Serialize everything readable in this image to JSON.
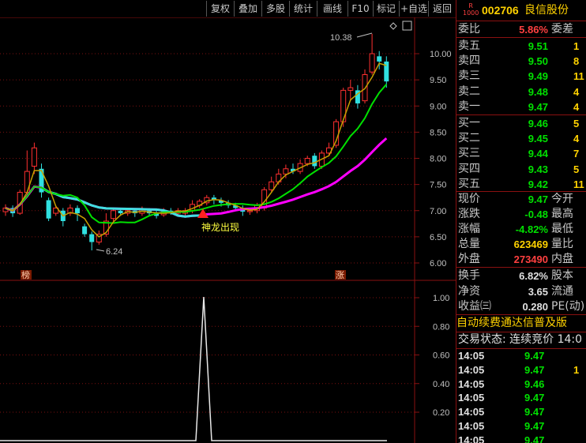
{
  "toolbar": {
    "buttons": [
      "复权",
      "叠加",
      "多股",
      "统计",
      "画线",
      "F10",
      "标记",
      "+自选",
      "返回"
    ]
  },
  "stock": {
    "badge_top": "R",
    "badge_bottom": "1000",
    "code": "002706",
    "name": "良信股份"
  },
  "order_book": {
    "weibi_label": "委比",
    "weibi_value": "5.86%",
    "weicha_label": "委差",
    "sell": [
      {
        "label": "卖五",
        "price": "9.51",
        "vol": "1"
      },
      {
        "label": "卖四",
        "price": "9.50",
        "vol": "8"
      },
      {
        "label": "卖三",
        "price": "9.49",
        "vol": "11"
      },
      {
        "label": "卖二",
        "price": "9.48",
        "vol": "4"
      },
      {
        "label": "卖一",
        "price": "9.47",
        "vol": "4"
      }
    ],
    "buy": [
      {
        "label": "买一",
        "price": "9.46",
        "vol": "5"
      },
      {
        "label": "买二",
        "price": "9.45",
        "vol": "4"
      },
      {
        "label": "买三",
        "price": "9.44",
        "vol": "7"
      },
      {
        "label": "买四",
        "price": "9.43",
        "vol": "5"
      },
      {
        "label": "买五",
        "price": "9.42",
        "vol": "11"
      }
    ]
  },
  "quote": {
    "rows": [
      {
        "label": "现价",
        "value": "9.47",
        "color": "#00e000",
        "label2": "今开"
      },
      {
        "label": "涨跌",
        "value": "-0.48",
        "color": "#00e000",
        "label2": "最高"
      },
      {
        "label": "涨幅",
        "value": "-4.82%",
        "color": "#00e000",
        "label2": "最低"
      },
      {
        "label": "总量",
        "value": "623469",
        "color": "#ffd200",
        "label2": "量比"
      },
      {
        "label": "外盘",
        "value": "273490",
        "color": "#ff4040",
        "label2": "内盘"
      }
    ],
    "rows2": [
      {
        "label": "换手",
        "value": "6.82%",
        "color": "#e0e0e0",
        "label2": "股本"
      },
      {
        "label": "净资",
        "value": "3.65",
        "color": "#e0e0e0",
        "label2": "流通"
      },
      {
        "label": "收益㈢",
        "value": "0.280",
        "color": "#e0e0e0",
        "label2": "PE(动)"
      }
    ]
  },
  "marquee": "自动续费通达信普及版",
  "trade_status": "交易状态: 连续竞价 14:0",
  "ticks": [
    {
      "time": "14:05",
      "price": "9.47",
      "color": "#00e000",
      "vol": ""
    },
    {
      "time": "14:05",
      "price": "9.47",
      "color": "#00e000",
      "vol": "1"
    },
    {
      "time": "14:05",
      "price": "9.46",
      "color": "#00e000",
      "vol": ""
    },
    {
      "time": "14:05",
      "price": "9.47",
      "color": "#00e000",
      "vol": ""
    },
    {
      "time": "14:05",
      "price": "9.47",
      "color": "#00e000",
      "vol": ""
    },
    {
      "time": "14:05",
      "price": "9.47",
      "color": "#00e000",
      "vol": ""
    },
    {
      "time": "14:05",
      "price": "9.47",
      "color": "#00e000",
      "vol": ""
    }
  ],
  "chart": {
    "price_axis": [
      "10.00",
      "9.50",
      "9.00",
      "8.50",
      "8.00",
      "7.50",
      "7.00",
      "6.50",
      "6.00"
    ],
    "indicator_axis": [
      "1.00",
      "0.80",
      "0.60",
      "0.40",
      "0.20"
    ],
    "high_label": "10.38",
    "low_label": "6.24",
    "signal_label": "神龙出现",
    "tag_left": "榜",
    "tag_right": "涨",
    "colors": {
      "up": "#ff3030",
      "down": "#30e0e0",
      "ma_fast": "#c8a000",
      "ma_mid": "#00e000",
      "ma_slow": "#ff00ff",
      "ma_cyan": "#40e0e0"
    }
  }
}
